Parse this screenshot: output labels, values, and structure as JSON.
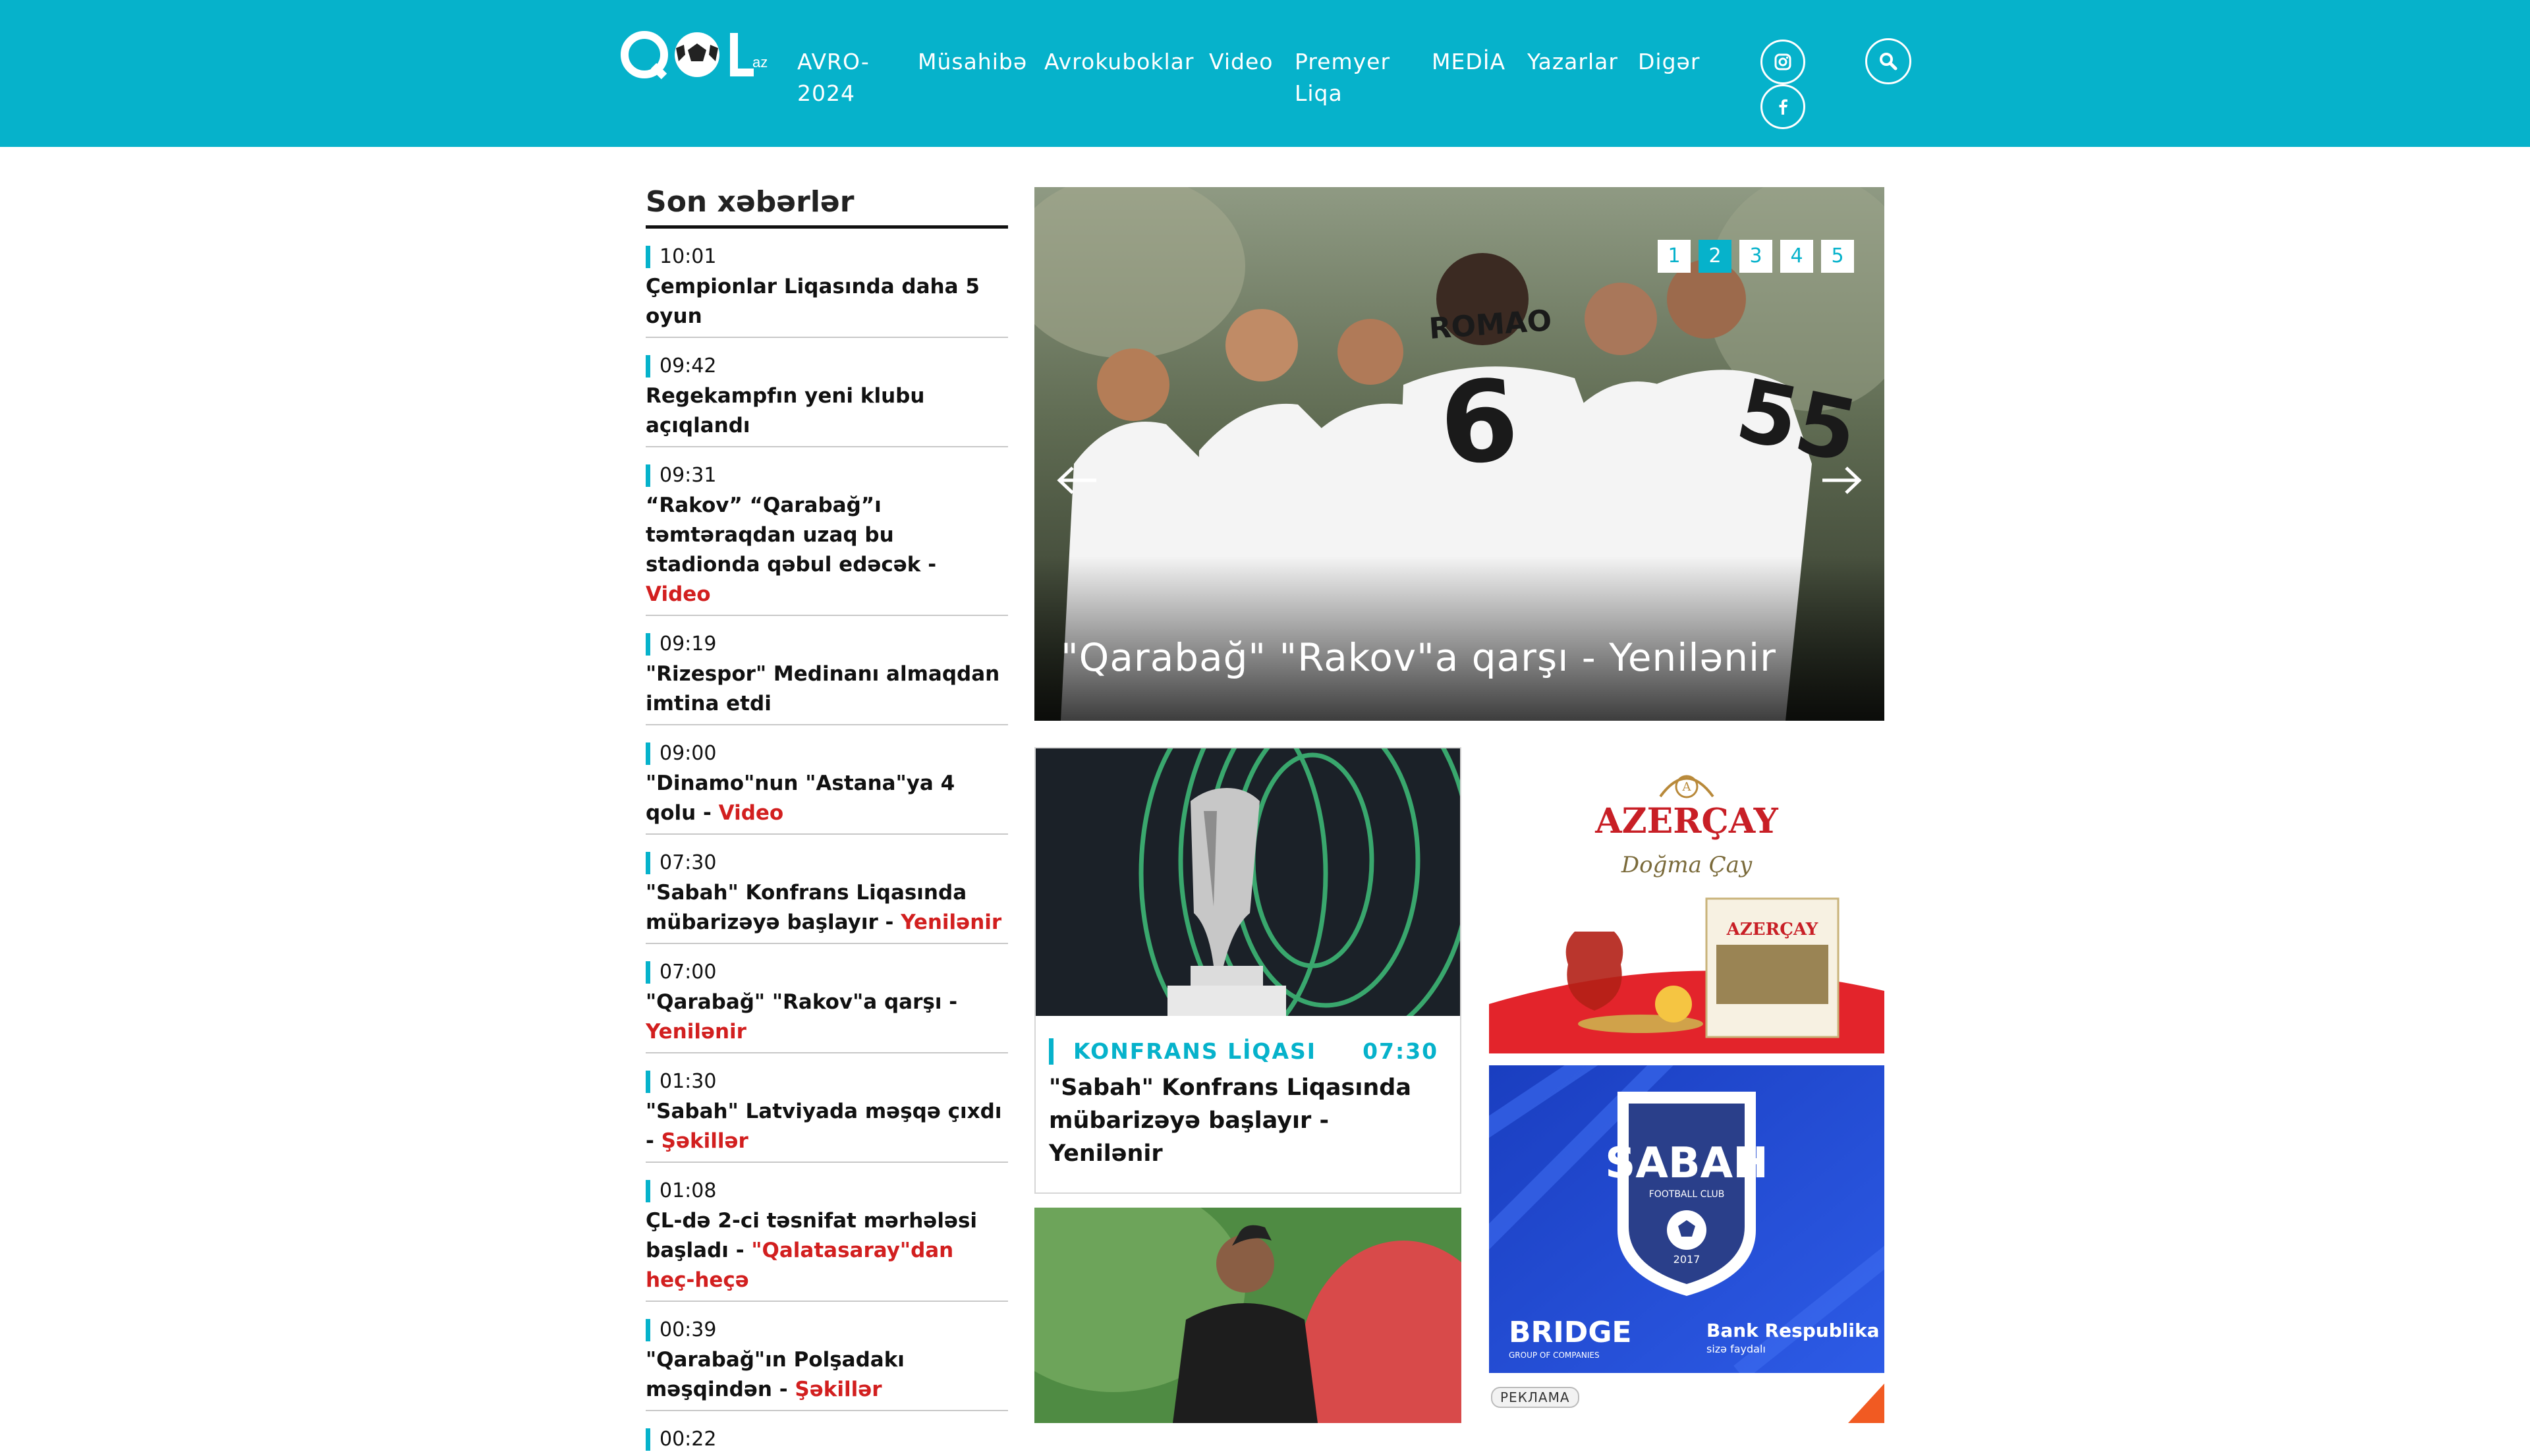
{
  "header": {
    "logo_text": "QOL.az",
    "nav": [
      {
        "label_line1": "AVRO-",
        "label_line2": "2024"
      },
      {
        "label_line1": "Müsahibə",
        "label_line2": ""
      },
      {
        "label_line1": "Avrokuboklar",
        "label_line2": ""
      },
      {
        "label_line1": "Video",
        "label_line2": ""
      },
      {
        "label_line1": "Premyer",
        "label_line2": "Liqa"
      },
      {
        "label_line1": "MEDİA",
        "label_line2": ""
      },
      {
        "label_line1": "Yazarlar",
        "label_line2": ""
      },
      {
        "label_line1": "Digər",
        "label_line2": ""
      }
    ],
    "social": [
      "instagram-icon",
      "facebook-icon"
    ],
    "search_icon": "search-icon"
  },
  "sidebar": {
    "title": "Son xəbərlər",
    "items": [
      {
        "time": "10:01",
        "title": "Çempionlar Liqasında daha 5 oyun",
        "tag": ""
      },
      {
        "time": "09:42",
        "title": "Regekampfın yeni klubu açıqlandı",
        "tag": ""
      },
      {
        "time": "09:31",
        "title": "“Rakov” “Qarabağ”ı təmtəraqdan uzaq bu stadionda qəbul edəcək - ",
        "tag": "Video"
      },
      {
        "time": "09:19",
        "title": "\"Rizespor\" Medinanı almaqdan imtina etdi",
        "tag": ""
      },
      {
        "time": "09:00",
        "title": "\"Dinamo\"nun \"Astana\"ya 4 qolu - ",
        "tag": "Video"
      },
      {
        "time": "07:30",
        "title": "\"Sabah\" Konfrans Liqasında mübarizəyə başlayır - ",
        "tag": "Yenilənir"
      },
      {
        "time": "07:00",
        "title": "\"Qarabağ\" \"Rakov\"a qarşı - ",
        "tag": "Yenilənir"
      },
      {
        "time": "01:30",
        "title": "\"Sabah\" Latviyada məşqə çıxdı - ",
        "tag": "Şəkillər"
      },
      {
        "time": "01:08",
        "title": "ÇL-də 2-ci təsnifat mərhələsi başladı - ",
        "tag": "\"Qalatasaray\"dan heç-heçə"
      },
      {
        "time": "00:39",
        "title": "\"Qarabağ\"ın Polşadakı məşqindən - ",
        "tag": "Şəkillər"
      },
      {
        "time": "00:22",
        "title": "",
        "tag": ""
      }
    ]
  },
  "slider": {
    "caption": "\"Qarabağ\" \"Rakov\"a qarşı - Yenilənir",
    "pages": [
      "1",
      "2",
      "3",
      "4",
      "5"
    ],
    "active_page": "2",
    "jersey_names": [
      "ROMAO",
      "6",
      "55"
    ]
  },
  "card": {
    "category": "KONFRANS LİQASI",
    "time": "07:30",
    "title": "\"Sabah\" Konfrans Liqasında mübarizəyə başlayır - Yenilənir"
  },
  "ads": {
    "azercay_brand": "AZERÇAY",
    "azercay_slogan": "Doğma Çay",
    "sabah_brand": "SABAH",
    "sabah_sub": "FOOTBALL CLUB",
    "sabah_year": "2017",
    "bridge": "BRIDGE",
    "bridge_sub": "GROUP OF COMPANIES",
    "bank": "Bank Respublika",
    "bank_sub": "sizə faydalı",
    "label": "РЕКЛАМА"
  }
}
